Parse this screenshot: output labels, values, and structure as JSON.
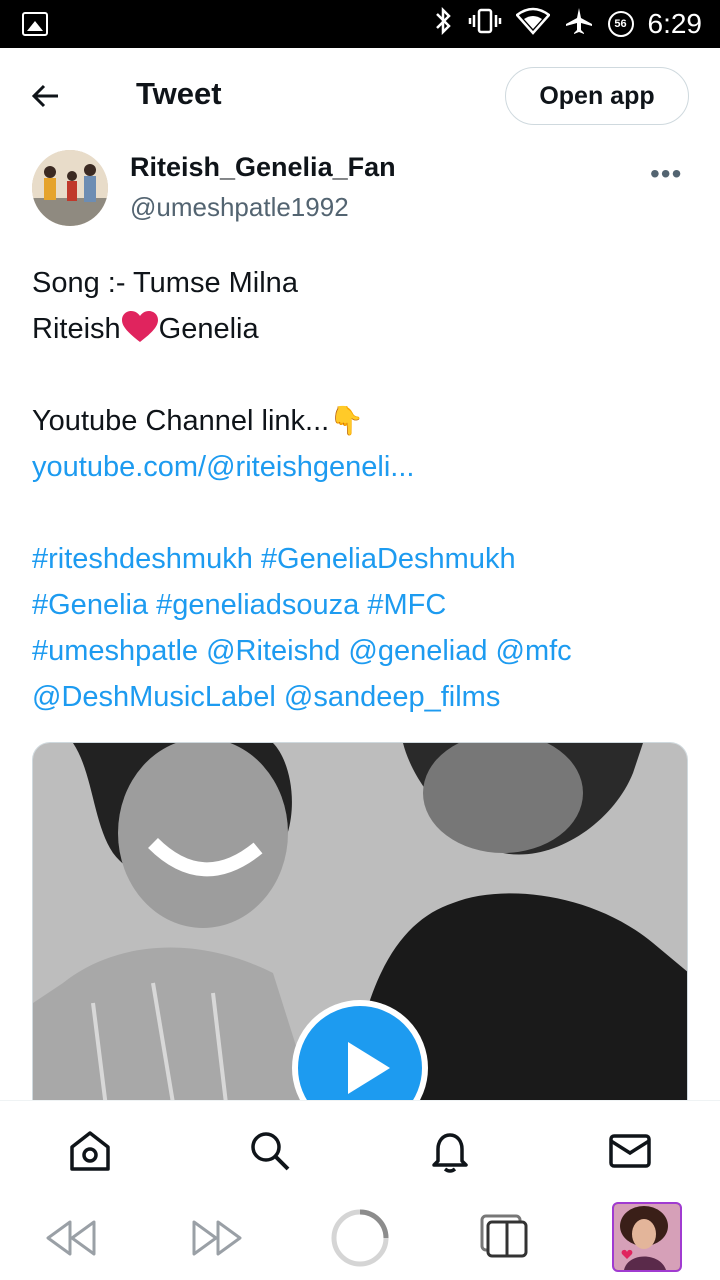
{
  "status_bar": {
    "time": "6:29",
    "badge": "56"
  },
  "header": {
    "title": "Tweet",
    "open_app_label": "Open app"
  },
  "tweet": {
    "author_name": "Riteish_Genelia_Fan",
    "author_handle": "@umeshpatle1992",
    "line1": "Song :- Tumse Milna",
    "line2_a": "Riteish",
    "line2_b": "Genelia",
    "line4": "Youtube Channel link...",
    "link": "youtube.com/@riteishgeneli...",
    "hashtags": [
      "#riteshdeshmukh #GeneliaDeshmukh",
      "#Genelia #geneliadsouza #MFC",
      "#umeshpatle @Riteishd @geneliad @mfc",
      "@DeshMusicLabel @sandeep_films"
    ]
  },
  "colors": {
    "link": "#1d9bf0",
    "play": "#1d9bf0",
    "heart": "#e0245e",
    "tab_border": "#a03bd1"
  },
  "icons": {
    "bottom_nav": [
      "home-icon",
      "search-icon",
      "bell-icon",
      "mail-icon"
    ],
    "browser": [
      "rewind-icon",
      "fast-forward-icon",
      "loading-icon",
      "tabs-icon"
    ]
  }
}
